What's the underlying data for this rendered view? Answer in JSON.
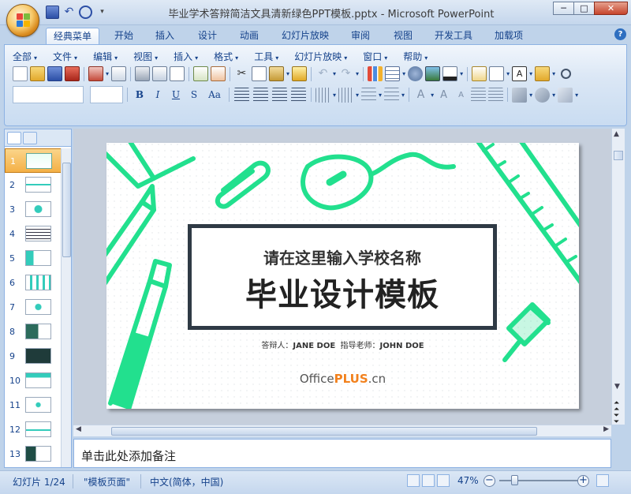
{
  "window": {
    "title": "毕业学术答辩简洁文具清新绿色PPT模板.pptx - Microsoft PowerPoint",
    "minimize": "─",
    "maximize": "□",
    "close": "✕"
  },
  "tabs": [
    "经典菜单",
    "开始",
    "插入",
    "设计",
    "动画",
    "幻灯片放映",
    "审阅",
    "视图",
    "开发工具",
    "加载项"
  ],
  "help": "?",
  "menus": [
    "全部",
    "文件",
    "编辑",
    "视图",
    "插入",
    "格式",
    "工具",
    "幻灯片放映",
    "窗口",
    "帮助"
  ],
  "format_buttons": [
    "B",
    "I",
    "U",
    "S",
    "Aa"
  ],
  "slides": {
    "numbers": [
      "1",
      "2",
      "3",
      "4",
      "5",
      "6",
      "7",
      "8",
      "9",
      "10",
      "11",
      "12",
      "13"
    ],
    "selected": "1"
  },
  "slide": {
    "subtitle": "请在这里输入学校名称",
    "main_title": "毕业设计模板",
    "respondent_label": "答辩人：",
    "respondent": "JANE DOE",
    "advisor_label": "指导老师：",
    "advisor": "JOHN DOE",
    "brand_a": "Office",
    "brand_b": "PLUS",
    "brand_c": ".cn",
    "accent_color": "#22e08e"
  },
  "notes": {
    "placeholder": "单击此处添加备注"
  },
  "status": {
    "slide_count": "幻灯片 1/24",
    "theme": "\"模板页面\"",
    "language": "中文(简体，中国)",
    "zoom": "47%",
    "zoom_minus": "−",
    "zoom_plus": "+"
  }
}
